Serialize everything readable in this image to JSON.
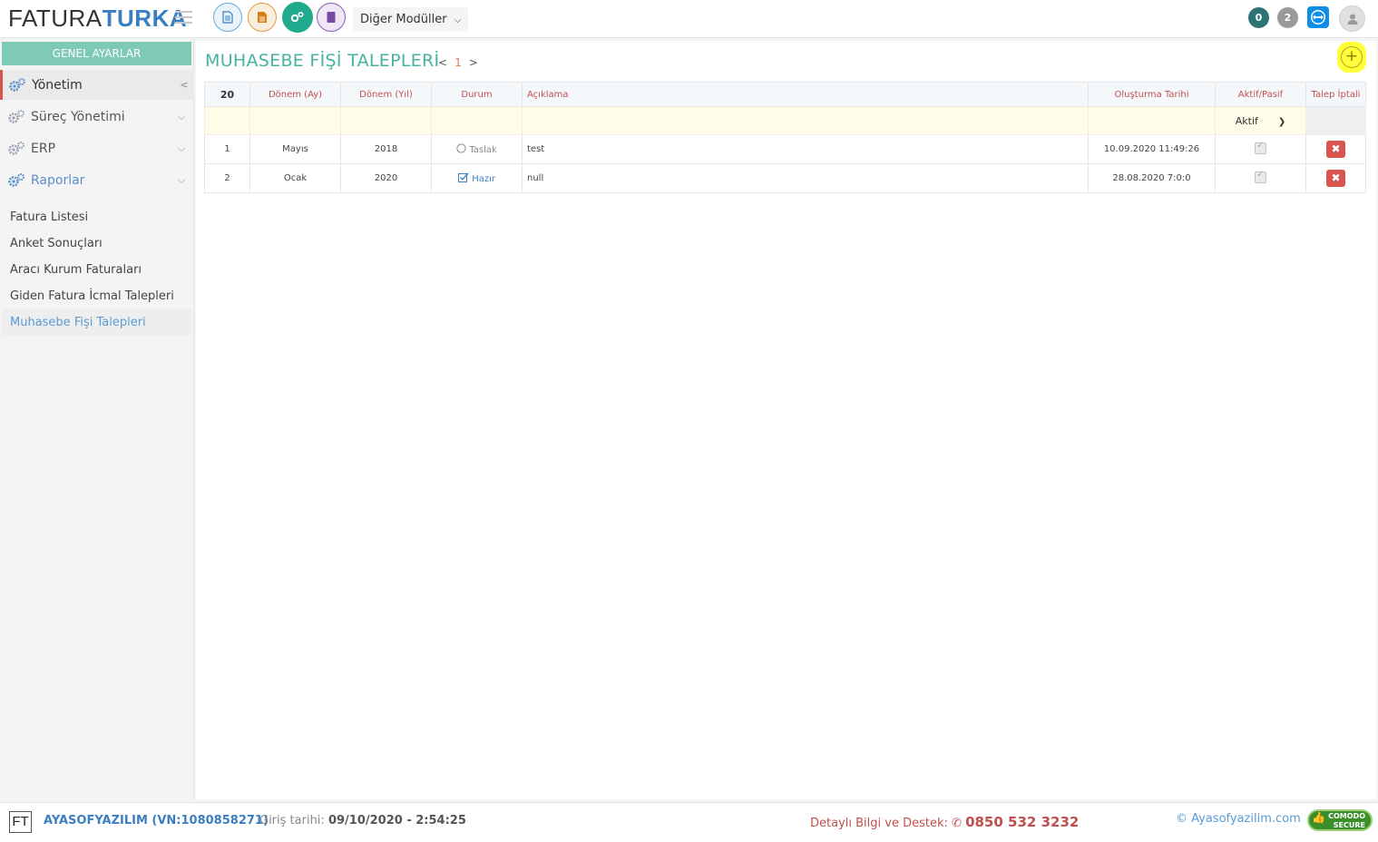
{
  "header": {
    "logo_light": "FATURA",
    "logo_bold": "TURKA",
    "modules_dropdown": "Diğer Modüller",
    "badge_a": "0",
    "badge_b": "2"
  },
  "sidebar": {
    "section_title": "GENEL AYARLAR",
    "menu": [
      {
        "label": "Yönetim"
      },
      {
        "label": "Süreç Yönetimi"
      },
      {
        "label": "ERP"
      },
      {
        "label": "Raporlar"
      }
    ],
    "sub_items": [
      {
        "label": "Fatura Listesi"
      },
      {
        "label": "Anket Sonuçları"
      },
      {
        "label": "Aracı Kurum Faturaları"
      },
      {
        "label": "Giden Fatura İcmal Talepleri"
      },
      {
        "label": "Muhasebe Fişi Talepleri"
      }
    ]
  },
  "main": {
    "title": "MUHASEBE FİŞİ TALEPLERİ",
    "pager": {
      "prev": "<",
      "current": "1",
      "next": ">"
    },
    "add_symbol": "+",
    "table": {
      "page_size": "20",
      "columns": [
        "Dönem (Ay)",
        "Dönem (Yıl)",
        "Durum",
        "Açıklama",
        "Oluşturma Tarihi",
        "Aktif/Pasif",
        "Talep İptali"
      ],
      "filter_aktif": "Aktif",
      "rows": [
        {
          "no": "1",
          "ay": "Mayıs",
          "yil": "2018",
          "durum": "Taslak",
          "aciklama": "test",
          "tarih": "10.09.2020 11:49:26"
        },
        {
          "no": "2",
          "ay": "Ocak",
          "yil": "2020",
          "durum": "Hazır",
          "aciklama": "null",
          "tarih": "28.08.2020 7:0:0"
        }
      ]
    }
  },
  "footer": {
    "logo": "FT",
    "company": "AYASOFYAZILIM (VN:1080858271)",
    "login_label": "Giriş tarihi:",
    "login_value": "09/10/2020 - 2:54:25",
    "support_label": "Detaylı Bilgi ve Destek:",
    "support_phone": "0850 532 3232",
    "copyright": "© Ayasofyazilim.com",
    "secure_line1": "COMODO",
    "secure_line2": "SECURE"
  },
  "colors": {
    "accent_teal": "#45b3a0",
    "brand_blue": "#3a7fc1",
    "danger_red": "#d9534f",
    "highlight_yellow": "#ffff3a"
  }
}
